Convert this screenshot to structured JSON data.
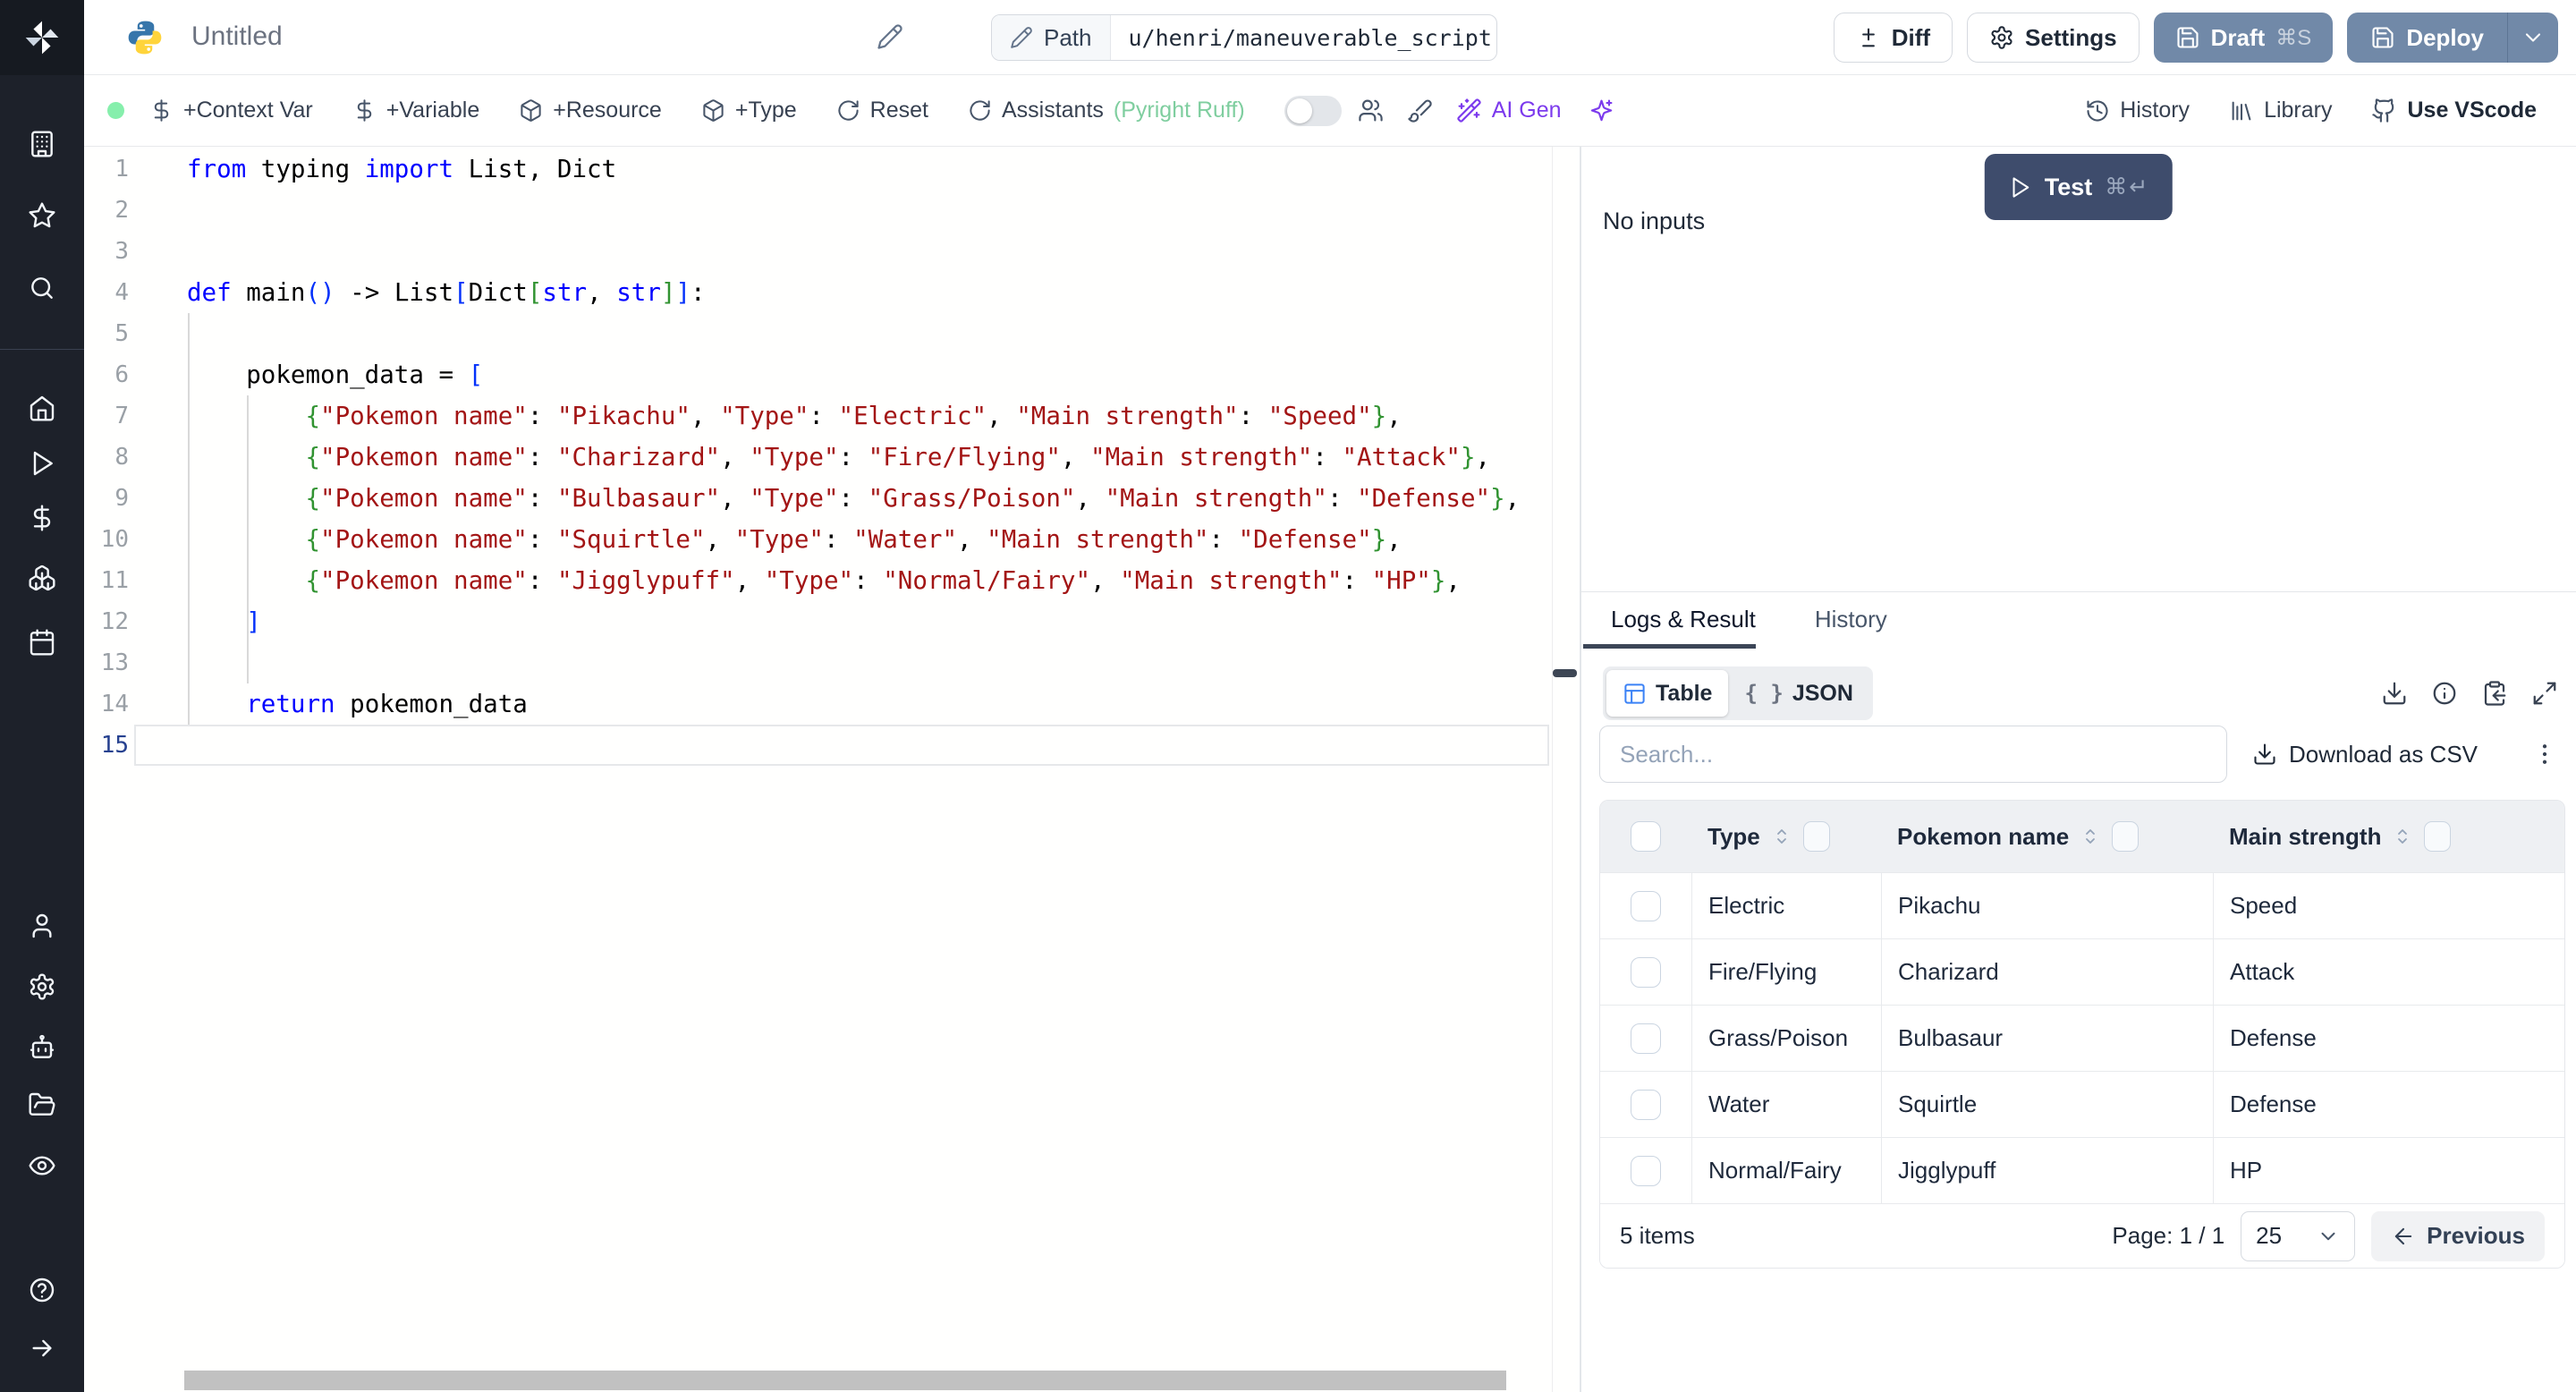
{
  "header": {
    "title": "Untitled",
    "path_label": "Path",
    "path_value": "u/henri/maneuverable_script",
    "diff_label": "Diff",
    "settings_label": "Settings",
    "draft_label": "Draft",
    "draft_kbd": "⌘S",
    "deploy_label": "Deploy"
  },
  "toolbar": {
    "context_var": "+Context Var",
    "variable": "+Variable",
    "resource": "+Resource",
    "type": "+Type",
    "reset": "Reset",
    "assistants": "Assistants",
    "assistants_hint": "(Pyright Ruff)",
    "ai_gen": "AI Gen",
    "history": "History",
    "library": "Library",
    "vscode": "Use VScode"
  },
  "sidebar": {
    "groups": [
      {
        "items": [
          "building",
          "star",
          "search"
        ]
      },
      {
        "items": [
          "home",
          "play",
          "dollar",
          "boxes",
          "calendar"
        ]
      },
      {
        "items": [
          "user",
          "gear",
          "bot",
          "folder-open",
          "eye"
        ]
      },
      {
        "items": [
          "help",
          "arrow-right"
        ]
      }
    ]
  },
  "editor": {
    "lines": [
      {
        "n": 1,
        "tokens": [
          [
            "k",
            "from"
          ],
          [
            "p",
            " typing "
          ],
          [
            "k",
            "import"
          ],
          [
            "p",
            " List, Dict"
          ]
        ]
      },
      {
        "n": 2,
        "tokens": []
      },
      {
        "n": 3,
        "tokens": []
      },
      {
        "n": 4,
        "tokens": [
          [
            "k",
            "def"
          ],
          [
            "p",
            " main"
          ],
          [
            "b1",
            "()"
          ],
          [
            "p",
            " -> List"
          ],
          [
            "b1",
            "["
          ],
          [
            "p",
            "Dict"
          ],
          [
            "b2",
            "["
          ],
          [
            "k",
            "str"
          ],
          [
            "p",
            ", "
          ],
          [
            "k",
            "str"
          ],
          [
            "b2",
            "]"
          ],
          [
            "b1",
            "]"
          ],
          [
            "p",
            ":"
          ]
        ]
      },
      {
        "n": 5,
        "tokens": []
      },
      {
        "n": 6,
        "tokens": [
          [
            "p",
            "    pokemon_data = "
          ],
          [
            "b1",
            "["
          ]
        ]
      },
      {
        "n": 7,
        "tokens": [
          [
            "p",
            "        "
          ],
          [
            "b2",
            "{"
          ],
          [
            "s",
            "\"Pokemon name\""
          ],
          [
            "p",
            ": "
          ],
          [
            "s",
            "\"Pikachu\""
          ],
          [
            "p",
            ", "
          ],
          [
            "s",
            "\"Type\""
          ],
          [
            "p",
            ": "
          ],
          [
            "s",
            "\"Electric\""
          ],
          [
            "p",
            ", "
          ],
          [
            "s",
            "\"Main strength\""
          ],
          [
            "p",
            ": "
          ],
          [
            "s",
            "\"Speed\""
          ],
          [
            "b2",
            "}"
          ],
          [
            "p",
            ","
          ]
        ]
      },
      {
        "n": 8,
        "tokens": [
          [
            "p",
            "        "
          ],
          [
            "b2",
            "{"
          ],
          [
            "s",
            "\"Pokemon name\""
          ],
          [
            "p",
            ": "
          ],
          [
            "s",
            "\"Charizard\""
          ],
          [
            "p",
            ", "
          ],
          [
            "s",
            "\"Type\""
          ],
          [
            "p",
            ": "
          ],
          [
            "s",
            "\"Fire/Flying\""
          ],
          [
            "p",
            ", "
          ],
          [
            "s",
            "\"Main strength\""
          ],
          [
            "p",
            ": "
          ],
          [
            "s",
            "\"Attack\""
          ],
          [
            "b2",
            "}"
          ],
          [
            "p",
            ","
          ]
        ]
      },
      {
        "n": 9,
        "tokens": [
          [
            "p",
            "        "
          ],
          [
            "b2",
            "{"
          ],
          [
            "s",
            "\"Pokemon name\""
          ],
          [
            "p",
            ": "
          ],
          [
            "s",
            "\"Bulbasaur\""
          ],
          [
            "p",
            ", "
          ],
          [
            "s",
            "\"Type\""
          ],
          [
            "p",
            ": "
          ],
          [
            "s",
            "\"Grass/Poison\""
          ],
          [
            "p",
            ", "
          ],
          [
            "s",
            "\"Main strength\""
          ],
          [
            "p",
            ": "
          ],
          [
            "s",
            "\"Defense\""
          ],
          [
            "b2",
            "}"
          ],
          [
            "p",
            ","
          ]
        ]
      },
      {
        "n": 10,
        "tokens": [
          [
            "p",
            "        "
          ],
          [
            "b2",
            "{"
          ],
          [
            "s",
            "\"Pokemon name\""
          ],
          [
            "p",
            ": "
          ],
          [
            "s",
            "\"Squirtle\""
          ],
          [
            "p",
            ", "
          ],
          [
            "s",
            "\"Type\""
          ],
          [
            "p",
            ": "
          ],
          [
            "s",
            "\"Water\""
          ],
          [
            "p",
            ", "
          ],
          [
            "s",
            "\"Main strength\""
          ],
          [
            "p",
            ": "
          ],
          [
            "s",
            "\"Defense\""
          ],
          [
            "b2",
            "}"
          ],
          [
            "p",
            ","
          ]
        ]
      },
      {
        "n": 11,
        "tokens": [
          [
            "p",
            "        "
          ],
          [
            "b2",
            "{"
          ],
          [
            "s",
            "\"Pokemon name\""
          ],
          [
            "p",
            ": "
          ],
          [
            "s",
            "\"Jigglypuff\""
          ],
          [
            "p",
            ", "
          ],
          [
            "s",
            "\"Type\""
          ],
          [
            "p",
            ": "
          ],
          [
            "s",
            "\"Normal/Fairy\""
          ],
          [
            "p",
            ", "
          ],
          [
            "s",
            "\"Main strength\""
          ],
          [
            "p",
            ": "
          ],
          [
            "s",
            "\"HP\""
          ],
          [
            "b2",
            "}"
          ],
          [
            "p",
            ","
          ]
        ]
      },
      {
        "n": 12,
        "tokens": [
          [
            "p",
            "    "
          ],
          [
            "b1",
            "]"
          ]
        ]
      },
      {
        "n": 13,
        "tokens": []
      },
      {
        "n": 14,
        "tokens": [
          [
            "p",
            "    "
          ],
          [
            "k",
            "return"
          ],
          [
            "p",
            " pokemon_data"
          ]
        ]
      },
      {
        "n": 15,
        "tokens": [],
        "current": true
      }
    ]
  },
  "runner": {
    "test_label": "Test",
    "test_kbd": "⌘↵",
    "no_inputs": "No inputs"
  },
  "results": {
    "tabs": {
      "logs": "Logs & Result",
      "history": "History"
    },
    "view_toggle": {
      "table": "Table",
      "json": "JSON"
    },
    "search_placeholder": "Search...",
    "download_csv": "Download as CSV",
    "table": {
      "columns": [
        "Type",
        "Pokemon name",
        "Main strength"
      ],
      "rows": [
        [
          "Electric",
          "Pikachu",
          "Speed"
        ],
        [
          "Fire/Flying",
          "Charizard",
          "Attack"
        ],
        [
          "Grass/Poison",
          "Bulbasaur",
          "Defense"
        ],
        [
          "Water",
          "Squirtle",
          "Defense"
        ],
        [
          "Normal/Fairy",
          "Jigglypuff",
          "HP"
        ]
      ]
    },
    "footer": {
      "items_text": "5 items",
      "page_text": "Page: 1 / 1",
      "page_size": "25",
      "previous_label": "Previous"
    }
  },
  "colors": {
    "sidebar_bg": "#1d212a",
    "slate_button": "#7189a8",
    "test_button": "#3e4c6c",
    "lang_dot_green": "#86efac",
    "assistant_green": "#7fce9f",
    "ai_purple": "#7c3aed",
    "table_icon_blue": "#3b82f6",
    "keyword_blue": "#0000ff",
    "string_red": "#a31515",
    "bracket_blue": "#0431fa",
    "bracket_green": "#319331"
  }
}
